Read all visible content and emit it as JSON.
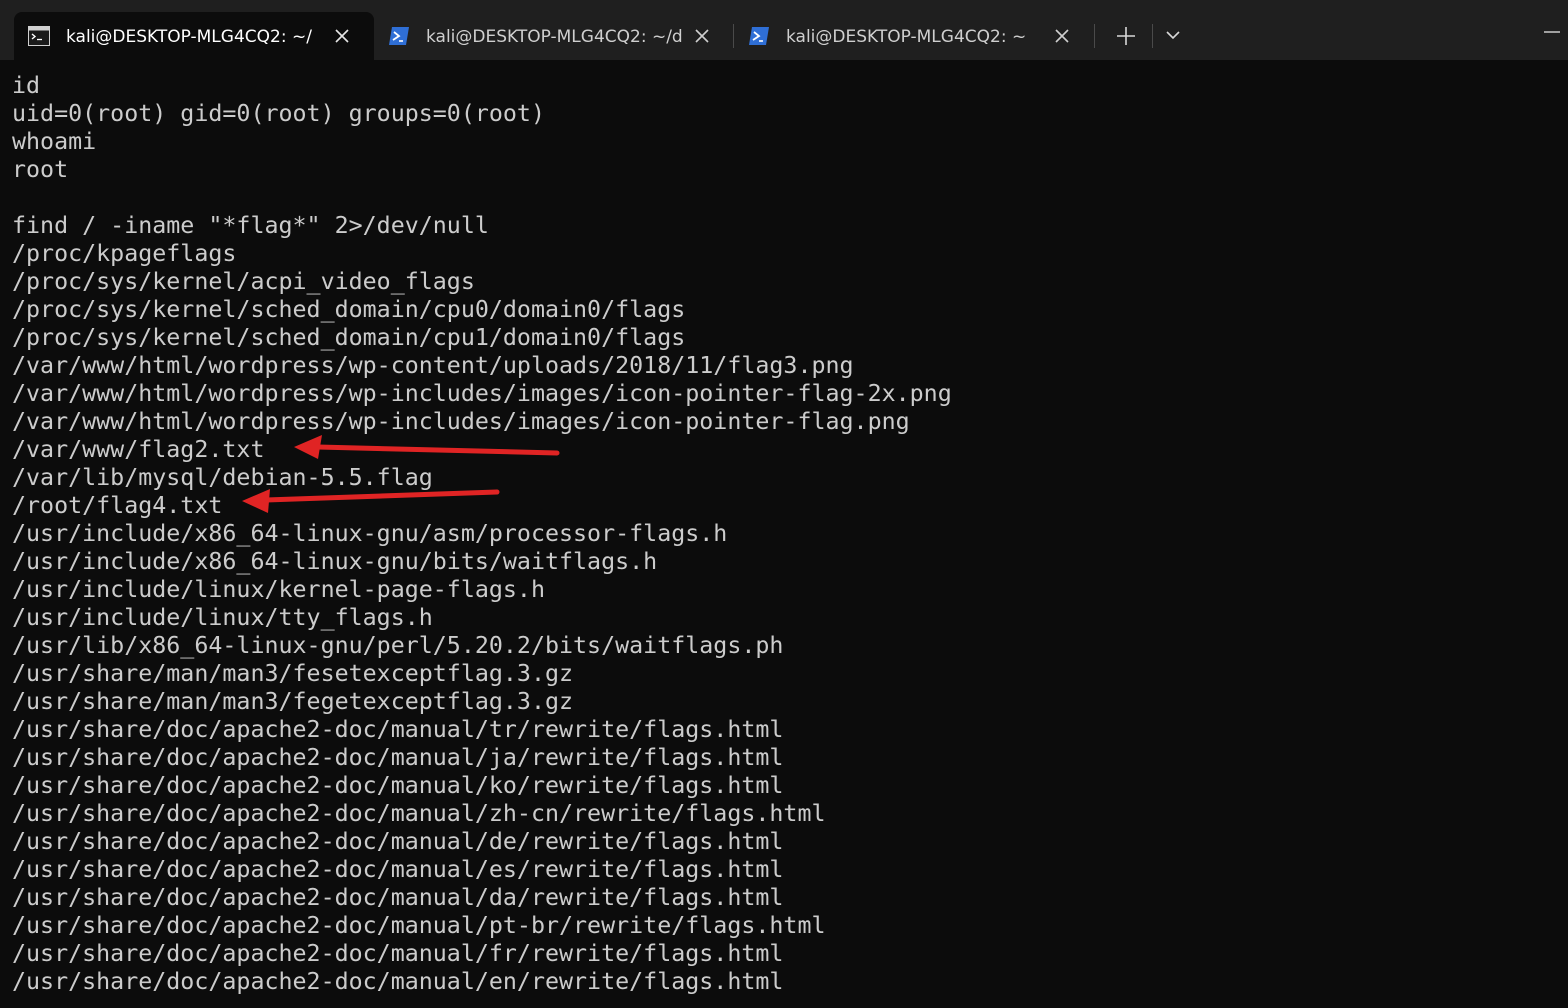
{
  "tabs": [
    {
      "title": "kali@DESKTOP-MLG4CQ2: ~/",
      "icon": "command-prompt-icon",
      "active": true
    },
    {
      "title": "kali@DESKTOP-MLG4CQ2: ~/d",
      "icon": "powershell-icon",
      "active": false
    },
    {
      "title": "kali@DESKTOP-MLG4CQ2: ~",
      "icon": "powershell-icon",
      "active": false
    }
  ],
  "tabbar": {
    "new_tab_icon": "plus-icon",
    "dropdown_icon": "chevron-down-icon",
    "minimize_icon": "minimize-icon"
  },
  "colors": {
    "terminal_bg": "#0c0c0c",
    "terminal_fg": "#cccccc",
    "tabbar_bg": "#1f1f1f",
    "arrow": "#e02424"
  },
  "terminal": {
    "lines": [
      "id",
      "uid=0(root) gid=0(root) groups=0(root)",
      "whoami",
      "root",
      "",
      "find / -iname \"*flag*\" 2>/dev/null",
      "/proc/kpageflags",
      "/proc/sys/kernel/acpi_video_flags",
      "/proc/sys/kernel/sched_domain/cpu0/domain0/flags",
      "/proc/sys/kernel/sched_domain/cpu1/domain0/flags",
      "/var/www/html/wordpress/wp-content/uploads/2018/11/flag3.png",
      "/var/www/html/wordpress/wp-includes/images/icon-pointer-flag-2x.png",
      "/var/www/html/wordpress/wp-includes/images/icon-pointer-flag.png",
      "/var/www/flag2.txt",
      "/var/lib/mysql/debian-5.5.flag",
      "/root/flag4.txt",
      "/usr/include/x86_64-linux-gnu/asm/processor-flags.h",
      "/usr/include/x86_64-linux-gnu/bits/waitflags.h",
      "/usr/include/linux/kernel-page-flags.h",
      "/usr/include/linux/tty_flags.h",
      "/usr/lib/x86_64-linux-gnu/perl/5.20.2/bits/waitflags.ph",
      "/usr/share/man/man3/fesetexceptflag.3.gz",
      "/usr/share/man/man3/fegetexceptflag.3.gz",
      "/usr/share/doc/apache2-doc/manual/tr/rewrite/flags.html",
      "/usr/share/doc/apache2-doc/manual/ja/rewrite/flags.html",
      "/usr/share/doc/apache2-doc/manual/ko/rewrite/flags.html",
      "/usr/share/doc/apache2-doc/manual/zh-cn/rewrite/flags.html",
      "/usr/share/doc/apache2-doc/manual/de/rewrite/flags.html",
      "/usr/share/doc/apache2-doc/manual/es/rewrite/flags.html",
      "/usr/share/doc/apache2-doc/manual/da/rewrite/flags.html",
      "/usr/share/doc/apache2-doc/manual/pt-br/rewrite/flags.html",
      "/usr/share/doc/apache2-doc/manual/fr/rewrite/flags.html",
      "/usr/share/doc/apache2-doc/manual/en/rewrite/flags.html"
    ]
  },
  "annotations": [
    {
      "name": "annotation-arrow-flag2",
      "icon": "red-arrow-icon",
      "points_to": "/var/www/flag2.txt"
    },
    {
      "name": "annotation-arrow-flag4",
      "icon": "red-arrow-icon",
      "points_to": "/root/flag4.txt"
    }
  ]
}
